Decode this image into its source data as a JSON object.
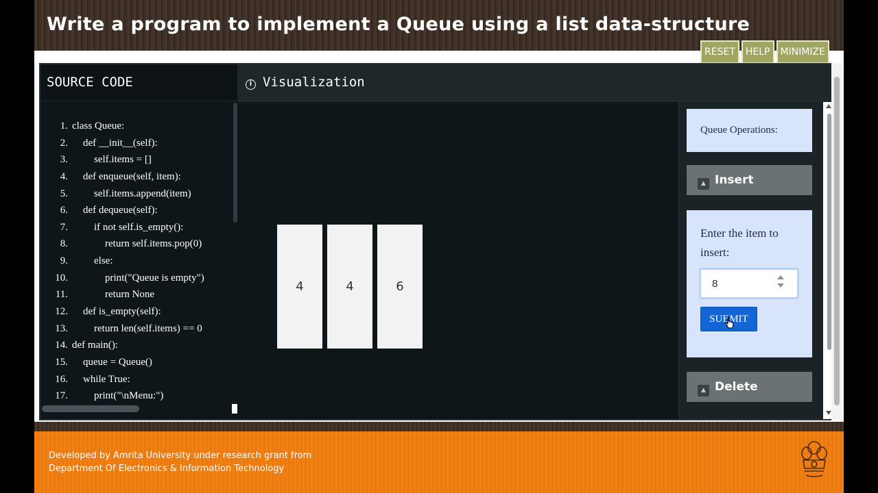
{
  "header": {
    "title": "Write a program to implement a Queue using a list data-structure",
    "buttons": [
      "RESET",
      "HELP",
      "MINIMIZE"
    ]
  },
  "source_panel": {
    "title": "SOURCE CODE",
    "lines": [
      {
        "n": "1.",
        "indent": 0,
        "code": "class Queue:"
      },
      {
        "n": "2.",
        "indent": 1,
        "code": "def __init__(self):"
      },
      {
        "n": "3.",
        "indent": 2,
        "code": "self.items = []"
      },
      {
        "n": "4.",
        "indent": 1,
        "code": "def enqueue(self, item):"
      },
      {
        "n": "5.",
        "indent": 2,
        "code": "self.items.append(item)"
      },
      {
        "n": "6.",
        "indent": 1,
        "code": "def dequeue(self):"
      },
      {
        "n": "7.",
        "indent": 2,
        "code": "if not self.is_empty():"
      },
      {
        "n": "8.",
        "indent": 3,
        "code": "return self.items.pop(0)"
      },
      {
        "n": "9.",
        "indent": 2,
        "code": "else:"
      },
      {
        "n": "10.",
        "indent": 3,
        "code": "print(\"Queue is empty\")"
      },
      {
        "n": "11.",
        "indent": 3,
        "code": "return None"
      },
      {
        "n": "12.",
        "indent": 1,
        "code": "def is_empty(self):"
      },
      {
        "n": "13.",
        "indent": 2,
        "code": "return len(self.items) == 0"
      },
      {
        "n": "14.",
        "indent": 0,
        "code": "def main():"
      },
      {
        "n": "15.",
        "indent": 1,
        "code": "queue = Queue()"
      },
      {
        "n": "16.",
        "indent": 1,
        "code": "while True:"
      },
      {
        "n": "17.",
        "indent": 2,
        "code": "print(\"\\nMenu:\")"
      }
    ]
  },
  "visualization": {
    "title": "Visualization",
    "queue_items": [
      "4",
      "4",
      "6"
    ]
  },
  "operations": {
    "title": "Queue Operations:",
    "insert_label": "Insert",
    "insert_prompt": "Enter the item to insert:",
    "input_value": "8",
    "submit_label": "SUBMIT",
    "delete_label": "Delete"
  },
  "footer": {
    "line1": "Developed by Amrita University under research grant from",
    "line2": "Department Of Electronics & Information Technology"
  }
}
